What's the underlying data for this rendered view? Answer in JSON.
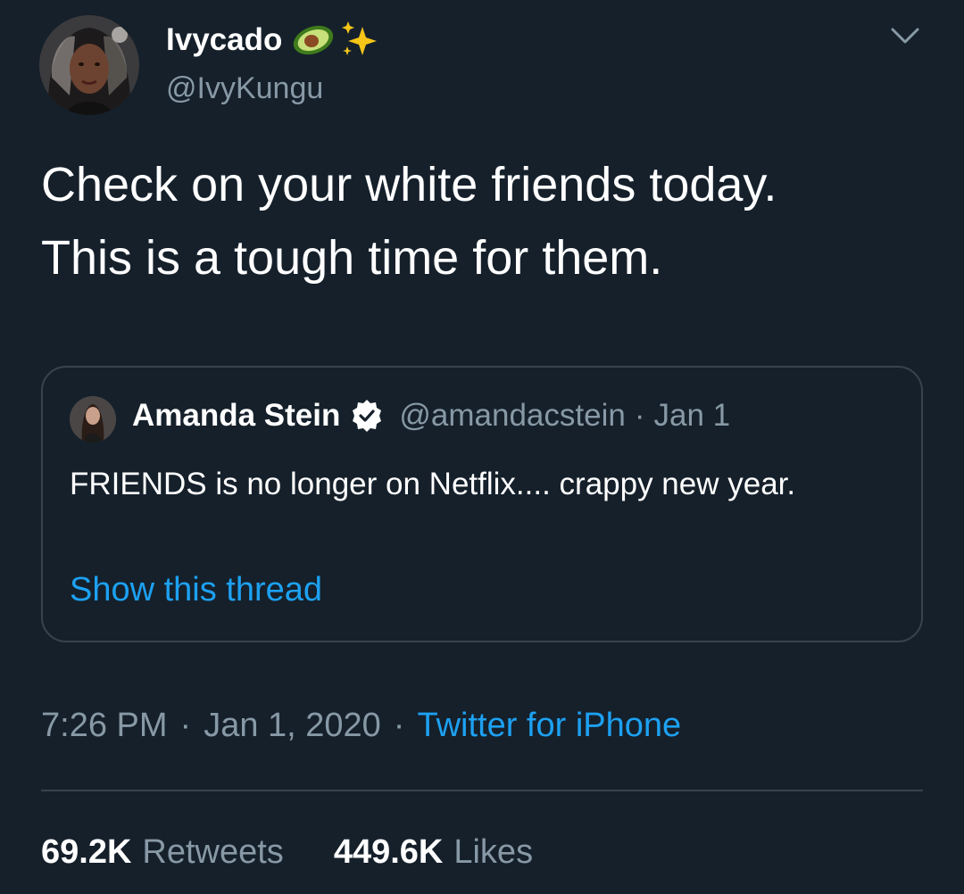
{
  "author": {
    "display_name": "Ivycado",
    "handle": "@IvyKungu",
    "name_emojis": [
      "avocado-icon",
      "sparkles-icon"
    ]
  },
  "tweet": {
    "text_line1": "Check on your white friends today.",
    "text_line2": "This is a tough time for them."
  },
  "quoted_tweet": {
    "display_name": "Amanda Stein",
    "verified": true,
    "handle": "@amandacstein",
    "separator": "·",
    "date": "Jan 1",
    "text": "FRIENDS is no longer on Netflix.... crappy new year.",
    "thread_link": "Show this thread"
  },
  "meta": {
    "time": "7:26 PM",
    "separator": "·",
    "date": "Jan 1, 2020",
    "source": "Twitter for iPhone"
  },
  "stats": {
    "retweets_count": "69.2K",
    "retweets_label": "Retweets",
    "likes_count": "449.6K",
    "likes_label": "Likes"
  },
  "colors": {
    "background": "#15202b",
    "text_primary": "#ffffff",
    "text_secondary": "#8899a6",
    "link": "#1da1f2",
    "border": "#38444d"
  }
}
